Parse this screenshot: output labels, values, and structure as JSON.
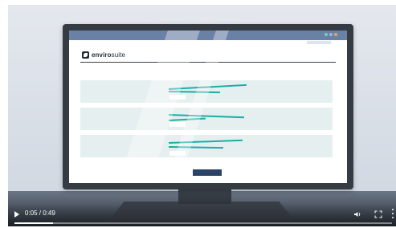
{
  "video": {
    "time_display": "0:05 / 0:49",
    "progress": 0.102
  },
  "screen": {
    "logo": {
      "prefix": "enviro",
      "suffix": "suite"
    }
  },
  "colors": {
    "topbar": "#6a81a6",
    "card": "#e6efef",
    "accent_teal": "#1aaea5",
    "button": "#2b4466"
  },
  "icons": [
    "play-icon",
    "volume-icon",
    "fullscreen-icon",
    "more-icon"
  ]
}
